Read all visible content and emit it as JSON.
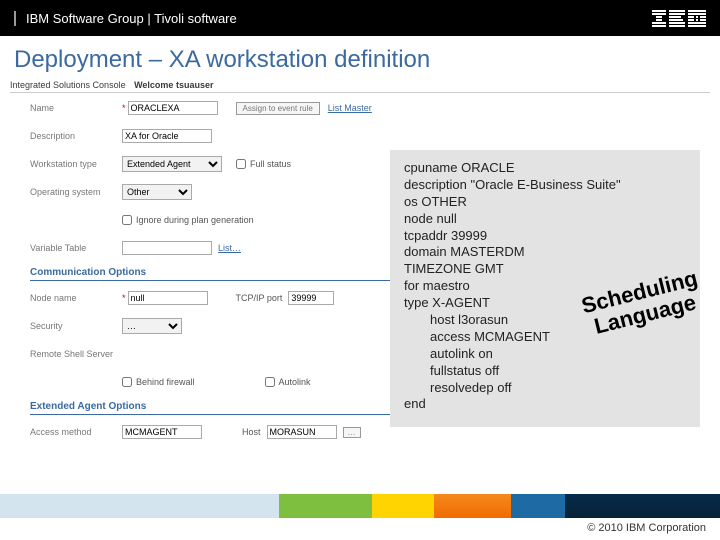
{
  "header": {
    "group": "IBM Software Group | Tivoli software"
  },
  "slide_title": "Deployment – XA workstation definition",
  "console": {
    "brand": "Integrated Solutions Console",
    "welcome": "Welcome tsuauser"
  },
  "form": {
    "name_label": "Name",
    "name_value": "ORACLEXA",
    "assign_btn": "Assign to event rule",
    "list_label": "List…",
    "save_link": "List Master",
    "desc_label": "Description",
    "desc_value": "XA for Oracle",
    "wtype_label": "Workstation type",
    "wtype_value": "Extended Agent",
    "fullstatus_label": "Full status",
    "os_label": "Operating system",
    "os_value": "Other",
    "ignore_label": "Ignore during plan generation",
    "vtable_label": "Variable Table",
    "comm_hdr": "Communication Options",
    "node_label": "Node name",
    "node_value": "null",
    "tcpip_label": "TCP/IP port",
    "tcpip_value": "39999",
    "sec_label": "Security",
    "rsh_label": "Remote Shell Server",
    "behind_label": "Behind firewall",
    "auto_label": "Autolink",
    "ext_hdr": "Extended Agent Options",
    "access_label": "Access method",
    "access_value": "MCMAGENT",
    "host_label": "Host",
    "host_value": "MORASUN"
  },
  "code": {
    "l1": "cpuname ORACLE",
    "l2": "description \"Oracle E-Business Suite\"",
    "l3": "os OTHER",
    "l4": "node null",
    "l5": "tcpaddr 39999",
    "l6": "domain MASTERDM",
    "l7": "TIMEZONE GMT",
    "l8": "for maestro",
    "l9": "type   X-AGENT",
    "i1": "host l3orasun",
    "i2": "access MCMAGENT",
    "i3": "autolink on",
    "i4": "fullstatus off",
    "i5": "resolvedep off",
    "l10": "end"
  },
  "stamp": {
    "line1": "Scheduling",
    "line2": "Language"
  },
  "footer": {
    "copy": "© 2010 IBM Corporation"
  }
}
